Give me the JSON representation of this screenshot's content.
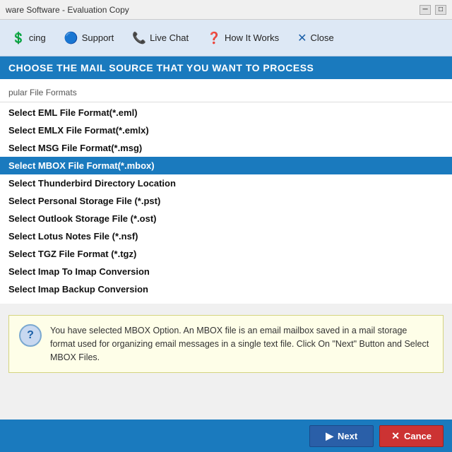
{
  "titleBar": {
    "text": "ware Software - Evaluation Copy",
    "minimizeLabel": "─",
    "maximizeLabel": "□"
  },
  "toolbar": {
    "items": [
      {
        "id": "pricing",
        "label": "cing",
        "icon": "💲"
      },
      {
        "id": "support",
        "label": "Support",
        "icon": "🔵"
      },
      {
        "id": "live-chat",
        "label": "Live Chat",
        "icon": "📞"
      },
      {
        "id": "how-it-works",
        "label": "How It Works",
        "icon": "❓"
      },
      {
        "id": "close",
        "label": "Close",
        "icon": "✕"
      }
    ]
  },
  "sectionHeader": {
    "text": "CHOOSE THE MAIL SOURCE THAT YOU WANT TO PROCESS"
  },
  "categoryLabel": "pular File Formats",
  "fileFormats": [
    {
      "id": "eml",
      "label": "Select EML File Format(*.eml)",
      "selected": false
    },
    {
      "id": "emlx",
      "label": "Select EMLX File Format(*.emlx)",
      "selected": false
    },
    {
      "id": "msg",
      "label": "Select MSG File Format(*.msg)",
      "selected": false
    },
    {
      "id": "mbox",
      "label": "Select MBOX File Format(*.mbox)",
      "selected": true
    },
    {
      "id": "thunderbird",
      "label": "Select Thunderbird Directory Location",
      "selected": false
    },
    {
      "id": "pst",
      "label": "Select Personal Storage File (*.pst)",
      "selected": false
    },
    {
      "id": "ost",
      "label": "Select Outlook Storage File (*.ost)",
      "selected": false
    },
    {
      "id": "nsf",
      "label": "Select Lotus Notes File (*.nsf)",
      "selected": false
    },
    {
      "id": "tgz",
      "label": "Select TGZ File Format (*.tgz)",
      "selected": false
    },
    {
      "id": "imap-convert",
      "label": "Select Imap To Imap Conversion",
      "selected": false
    },
    {
      "id": "imap-backup",
      "label": "Select Imap Backup Conversion",
      "selected": false
    }
  ],
  "infoBox": {
    "iconText": "?",
    "text": "You have selected MBOX Option. An MBOX file is an email mailbox saved in a mail storage format used for organizing email messages in a single text file. Click On \"Next\" Button and Select MBOX Files."
  },
  "footer": {
    "nextLabel": "Next",
    "cancelLabel": "Cance",
    "nextIcon": "▶",
    "cancelIcon": "✕"
  }
}
